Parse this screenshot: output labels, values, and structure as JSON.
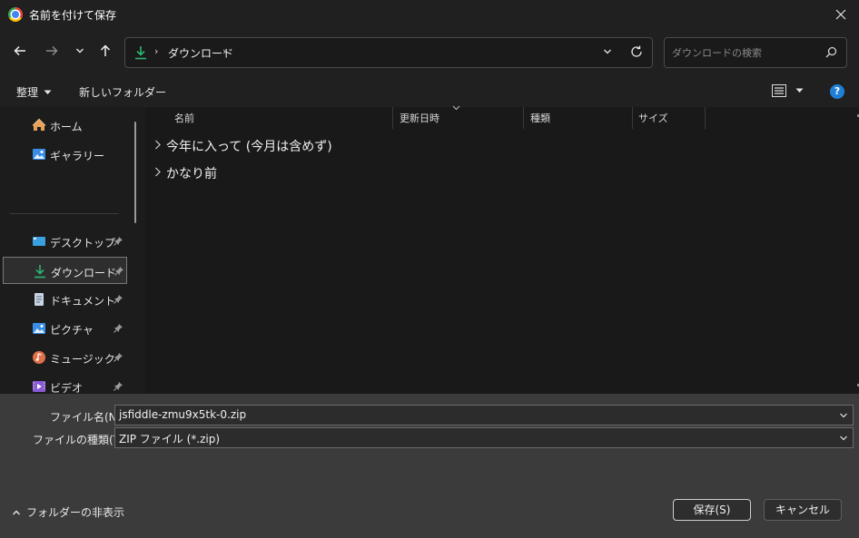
{
  "window": {
    "title": "名前を付けて保存",
    "icon": "chrome-logo-icon"
  },
  "navigation": {
    "breadcrumb": [
      "ダウンロード"
    ],
    "search_placeholder": "ダウンロードの検索"
  },
  "toolbar": {
    "organize_label": "整理",
    "new_folder_label": "新しいフォルダー"
  },
  "sidebar": {
    "items": [
      {
        "label": "ホーム",
        "icon": "home-icon",
        "pinned": false
      },
      {
        "label": "ギャラリー",
        "icon": "gallery-icon",
        "pinned": false
      },
      {
        "label": "デスクトップ",
        "icon": "desktop-icon",
        "pinned": true
      },
      {
        "label": "ダウンロード",
        "icon": "download-icon",
        "pinned": true,
        "selected": true
      },
      {
        "label": "ドキュメント",
        "icon": "document-icon",
        "pinned": true
      },
      {
        "label": "ピクチャ",
        "icon": "pictures-icon",
        "pinned": true
      },
      {
        "label": "ミュージック",
        "icon": "music-icon",
        "pinned": true
      },
      {
        "label": "ビデオ",
        "icon": "video-icon",
        "pinned": true
      }
    ]
  },
  "file_list": {
    "columns": [
      "名前",
      "更新日時",
      "種類",
      "サイズ"
    ],
    "groups": [
      "今年に入って (今月は含めず)",
      "かなり前"
    ]
  },
  "save_form": {
    "filename_label": "ファイル名(N):",
    "filename_value": "jsfiddle-zmu9x5tk-0.zip",
    "filetype_label": "ファイルの種類(T):",
    "filetype_value": "ZIP ファイル (*.zip)",
    "hide_folders_label": "フォルダーの非表示",
    "save_button": "保存(S)",
    "cancel_button": "キャンセル"
  },
  "colors": {
    "background": "#202020",
    "bottom_panel": "#3b3b3b",
    "accent": "#1f7fd6",
    "download_green": "#2bb673"
  }
}
